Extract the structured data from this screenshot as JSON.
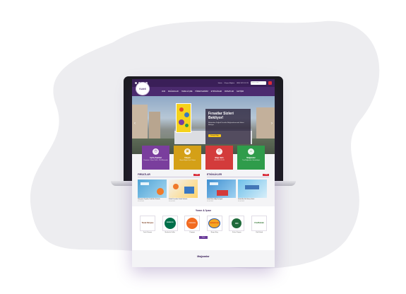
{
  "colors": {
    "brand_dark": "#3a1f58",
    "brand": "#4b2a6e",
    "accent_red": "#d92d3a",
    "accent_yellow": "#f5c518",
    "tile_purple": "#7a3e9d",
    "tile_yellow": "#d4a017",
    "tile_red": "#d33b3b",
    "tile_green": "#2f9c4b"
  },
  "topbar": {
    "links": [
      "Harita",
      "Ulaşım Bilgileri",
      "0850 XXX XX XX"
    ],
    "search_placeholder": "Arama yapın"
  },
  "logo": {
    "text": "Kuleli"
  },
  "nav": {
    "items": [
      "AVM",
      "MAĞAZALAR",
      "YEME & İÇME",
      "HİZMETLERİMİZ",
      "ETKİNLİKLER",
      "FIRSATLAR",
      "İLETİŞİM"
    ]
  },
  "hero": {
    "title": "Fırsatlar Sizleri Bekliyor!",
    "subtitle": "Birbirinden Değerli Fırsatlar Mağazalarımızda Sizleri Bekliyor.",
    "cta": "Detaylı Bilgi",
    "prev_icon": "chevron-left-icon",
    "next_icon": "chevron-right-icon"
  },
  "tiles": [
    {
      "title": "Açılış Saatleri",
      "sub": "Pazartesi - Pazar 10:00 - 22:00 Arasında",
      "icon": "clock-icon"
    },
    {
      "title": "Ulaşım",
      "sub": "Ulaşım Bilgileri İçin Tıklayın",
      "icon": "bus-icon"
    },
    {
      "title": "Bilgi Hattı",
      "sub": "0850 XXX XX XX",
      "icon": "phone-icon"
    },
    {
      "title": "Mağazalar",
      "sub": "Tüm Mağazaları Görüntüleyin",
      "icon": "store-icon"
    }
  ],
  "sections": {
    "deals": {
      "title": "FIRSATLAR",
      "all_label": "Tümü",
      "cards": [
        {
          "caption": "Dünyaca Popüler Kuleli'de Sizlerle",
          "date": "01.06.2019"
        },
        {
          "caption": "Kuleli Fırsatlar Kuleli Sizlerle",
          "date": "01.06.2019"
        }
      ]
    },
    "events": {
      "title": "ETKİNLİKLER",
      "all_label": "Tümü",
      "cards": [
        {
          "caption": "Kuleli Bulut Ağı Hediyeli",
          "date": "01.06.2019"
        },
        {
          "caption": "Kuleli Anı Bir Bakış Kuleli",
          "date": "01.06.2019"
        }
      ]
    }
  },
  "food": {
    "title": "Yeme & İçme",
    "button": "Tümü",
    "brands": [
      {
        "name": "Tavuk Dünyası",
        "logo": "Tavuk Dünyası",
        "icon": "tavuk-dunyasi-logo-icon"
      },
      {
        "name": "Starbucks Coffee",
        "logo": "STARBUCKS",
        "icon": "starbucks-logo-icon"
      },
      {
        "name": "Popeyes",
        "logo": "POPEYES",
        "icon": "popeyes-logo-icon"
      },
      {
        "name": "Burger King",
        "logo": "BURGER KING",
        "icon": "burger-king-logo-icon"
      },
      {
        "name": "Kahve Dünyası",
        "logo": "KD",
        "icon": "kahve-dunyasi-logo-icon"
      },
      {
        "name": "Chef Kebab",
        "logo": "ChefKebab",
        "icon": "chef-kebab-logo-icon"
      }
    ]
  },
  "stores": {
    "title": "Mağazalar"
  }
}
